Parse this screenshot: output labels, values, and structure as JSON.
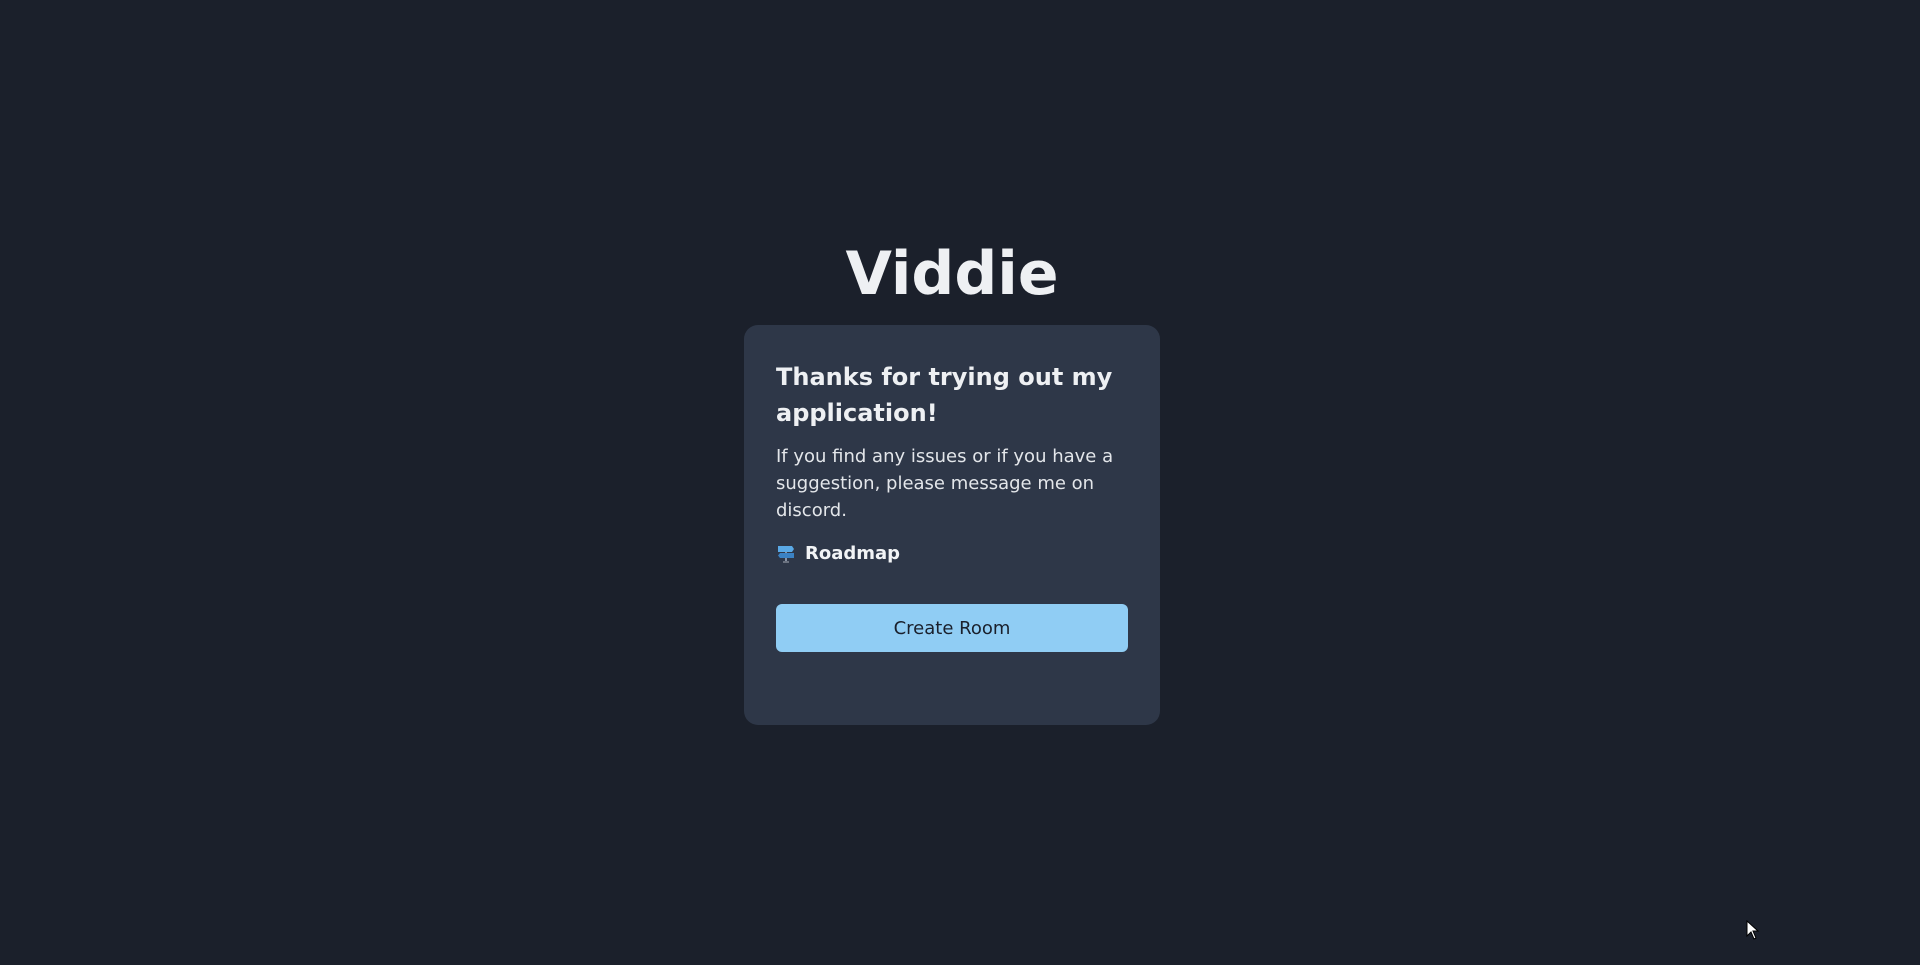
{
  "app": {
    "title": "Viddie"
  },
  "card": {
    "heading": "Thanks for trying out my application!",
    "text": "If you find any issues or if you have a suggestion, please message me on discord.",
    "roadmap": {
      "label": "Roadmap",
      "icon": "roadmap-sign-icon"
    },
    "create_button_label": "Create Room"
  },
  "colors": {
    "background": "#1b202b",
    "card": "#2e3748",
    "accent": "#90cdf4",
    "text": "#eef0f3"
  }
}
